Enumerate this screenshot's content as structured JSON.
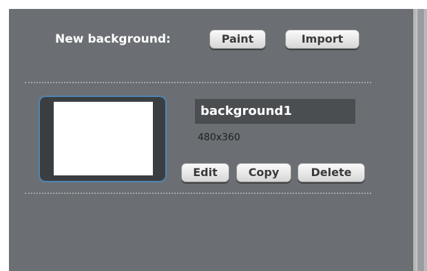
{
  "header": {
    "new_background_label": "New background:",
    "paint_label": "Paint",
    "import_label": "Import"
  },
  "background_item": {
    "name": "background1",
    "size": "480x360",
    "edit_label": "Edit",
    "copy_label": "Copy",
    "delete_label": "Delete"
  },
  "colors": {
    "panel": "#6b6f73",
    "thumbnail_border_accent": "#4f87b6",
    "button_text": "#3a3a3a"
  }
}
